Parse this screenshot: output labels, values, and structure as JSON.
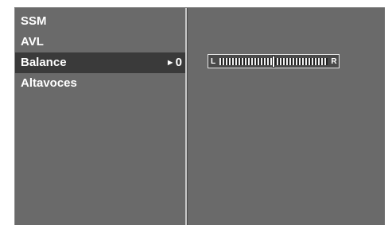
{
  "menu": {
    "items": [
      {
        "label": "SSM",
        "selected": false
      },
      {
        "label": "AVL",
        "selected": false
      },
      {
        "label": "Balance",
        "selected": true,
        "value": "0"
      },
      {
        "label": "Altavoces",
        "selected": false
      }
    ],
    "value_arrow_icon": "arrow-right-icon"
  },
  "balance": {
    "left_label": "L",
    "right_label": "R",
    "value": 0,
    "range": [
      -50,
      50
    ]
  },
  "colors": {
    "screen_background": "#6a6a6a",
    "selected_background": "#3a3a3a",
    "text": "#ffffff"
  }
}
